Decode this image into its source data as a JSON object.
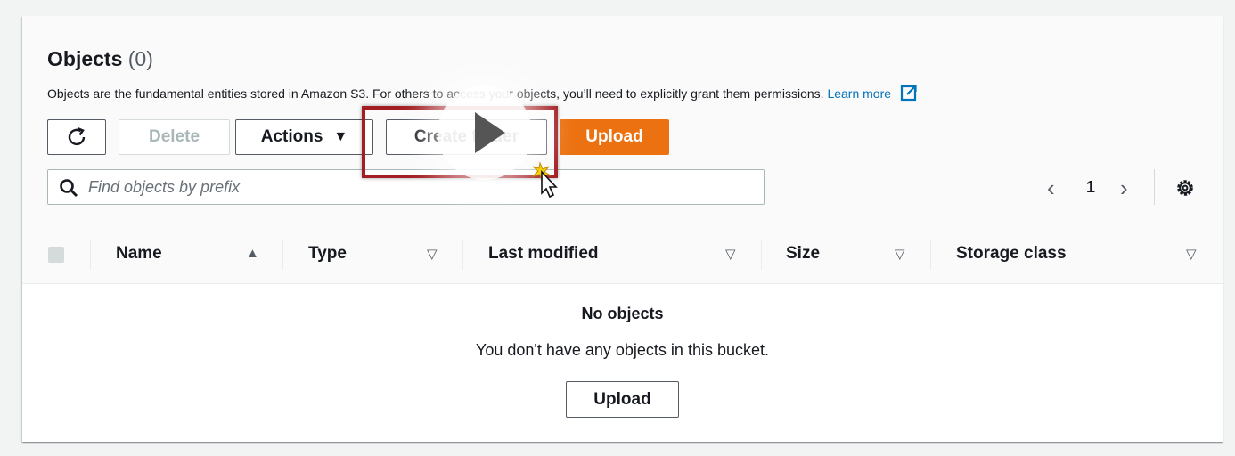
{
  "objects": {
    "title": "Objects",
    "count": "(0)",
    "description": "Objects are the fundamental entities stored in Amazon S3. For others to access your objects, you’ll need to explicitly grant them permissions.",
    "learn_more": "Learn more"
  },
  "toolbar": {
    "refresh_icon": "refresh-icon",
    "delete_label": "Delete",
    "actions_label": "Actions",
    "actions_caret": "▼",
    "create_folder_label": "Create folder",
    "upload_label": "Upload"
  },
  "search": {
    "placeholder": "Find objects by prefix",
    "value": ""
  },
  "pagination": {
    "prev": "‹",
    "page": "1",
    "next": "›",
    "settings_icon": "gear-icon"
  },
  "table": {
    "columns": [
      {
        "label": "Name",
        "sort": "▲"
      },
      {
        "label": "Type",
        "sort": "▽"
      },
      {
        "label": "Last modified",
        "sort": "▽"
      },
      {
        "label": "Size",
        "sort": "▽"
      },
      {
        "label": "Storage class",
        "sort": "▽"
      }
    ]
  },
  "empty_state": {
    "title": "No objects",
    "message": "You don't have any objects in this bucket.",
    "upload_label": "Upload"
  },
  "colors": {
    "primary_button": "#ec7211",
    "link": "#0073bb",
    "highlight": "#a31e22"
  }
}
